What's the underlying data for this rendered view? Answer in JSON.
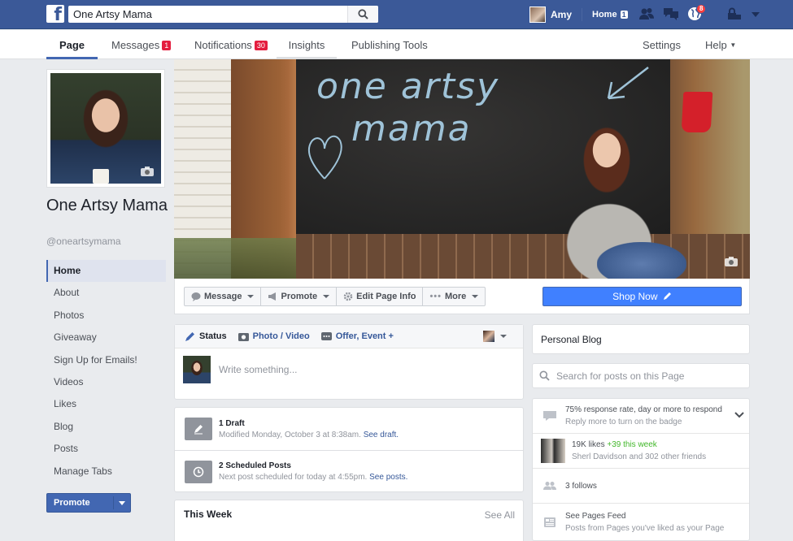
{
  "topbar": {
    "logo": "f",
    "search_value": "One Artsy Mama",
    "user_name": "Amy",
    "home_label": "Home",
    "home_count": "1",
    "notif_count": "8",
    "icons": [
      "friend-requests-icon",
      "messages-icon",
      "globe-notifications-icon",
      "lock-icon",
      "caret-down-icon"
    ]
  },
  "pagenav": {
    "page": "Page",
    "messages": "Messages",
    "messages_count": "1",
    "notifications": "Notifications",
    "notifications_count": "30",
    "insights": "Insights",
    "publishing_tools": "Publishing Tools",
    "settings": "Settings",
    "help": "Help"
  },
  "profile": {
    "name": "One Artsy Mama",
    "handle": "@oneartsymama"
  },
  "leftnav": {
    "items": [
      "Home",
      "About",
      "Photos",
      "Giveaway",
      "Sign Up for Emails!",
      "Videos",
      "Likes",
      "Blog",
      "Posts",
      "Manage Tabs"
    ],
    "active_index": 0,
    "promote_label": "Promote"
  },
  "cover": {
    "chalk_line1": "one artsy",
    "chalk_line2": "mama"
  },
  "actions": {
    "message": "Message",
    "promote": "Promote",
    "edit_page_info": "Edit Page Info",
    "more": "More",
    "shop_now": "Shop Now"
  },
  "composer": {
    "status": "Status",
    "photo_video": "Photo / Video",
    "offer_event": "Offer, Event +",
    "placeholder": "Write something..."
  },
  "drafts": {
    "draft_title": "1 Draft",
    "draft_sub": "Modified Monday, October 3 at 8:38am.",
    "draft_link": "See draft.",
    "scheduled_title": "2 Scheduled Posts",
    "scheduled_sub": "Next post scheduled for today at 4:55pm.",
    "scheduled_link": "See posts."
  },
  "this_week": {
    "title": "This Week",
    "see_all": "See All"
  },
  "right": {
    "category": "Personal Blog",
    "search_placeholder": "Search for posts on this Page",
    "response_rate": "75% response rate, day or more to respond",
    "response_sub": "Reply more to turn on the badge",
    "likes": "19K likes",
    "likes_delta": "+39 this week",
    "likes_friends": "Sherl Davidson and 302 other friends",
    "follows": "3 follows",
    "pages_feed": "See Pages Feed",
    "pages_feed_sub": "Posts from Pages you've liked as your Page"
  }
}
